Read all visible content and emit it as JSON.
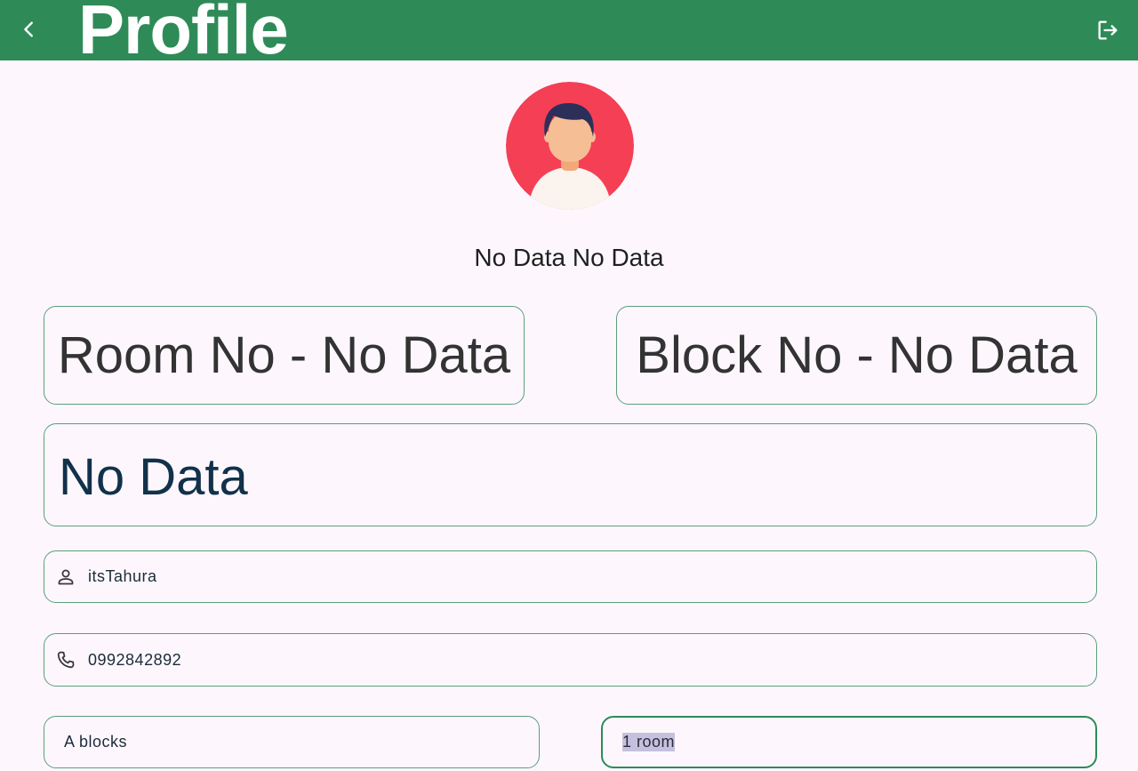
{
  "appbar": {
    "title": "Profile",
    "back_icon": "chevron-left-icon",
    "logout_icon": "logout-icon",
    "background_color": "#2e8b57"
  },
  "profile": {
    "avatar_icon": "user-avatar",
    "full_name": "No Data No Data"
  },
  "info_cards": {
    "room": "Room No - No Data",
    "block": "Block No - No Data",
    "extra": "No Data"
  },
  "fields": {
    "username": {
      "value": "itsTahura",
      "icon": "person-icon"
    },
    "phone": {
      "value": "0992842892",
      "icon": "phone-icon"
    },
    "block": {
      "value": "A blocks"
    },
    "room": {
      "value": "1 room"
    }
  },
  "colors": {
    "accent": "#2e8b57",
    "border": "#5b9e7a",
    "background": "#fdf7fd",
    "selection": "#c6c0df"
  }
}
